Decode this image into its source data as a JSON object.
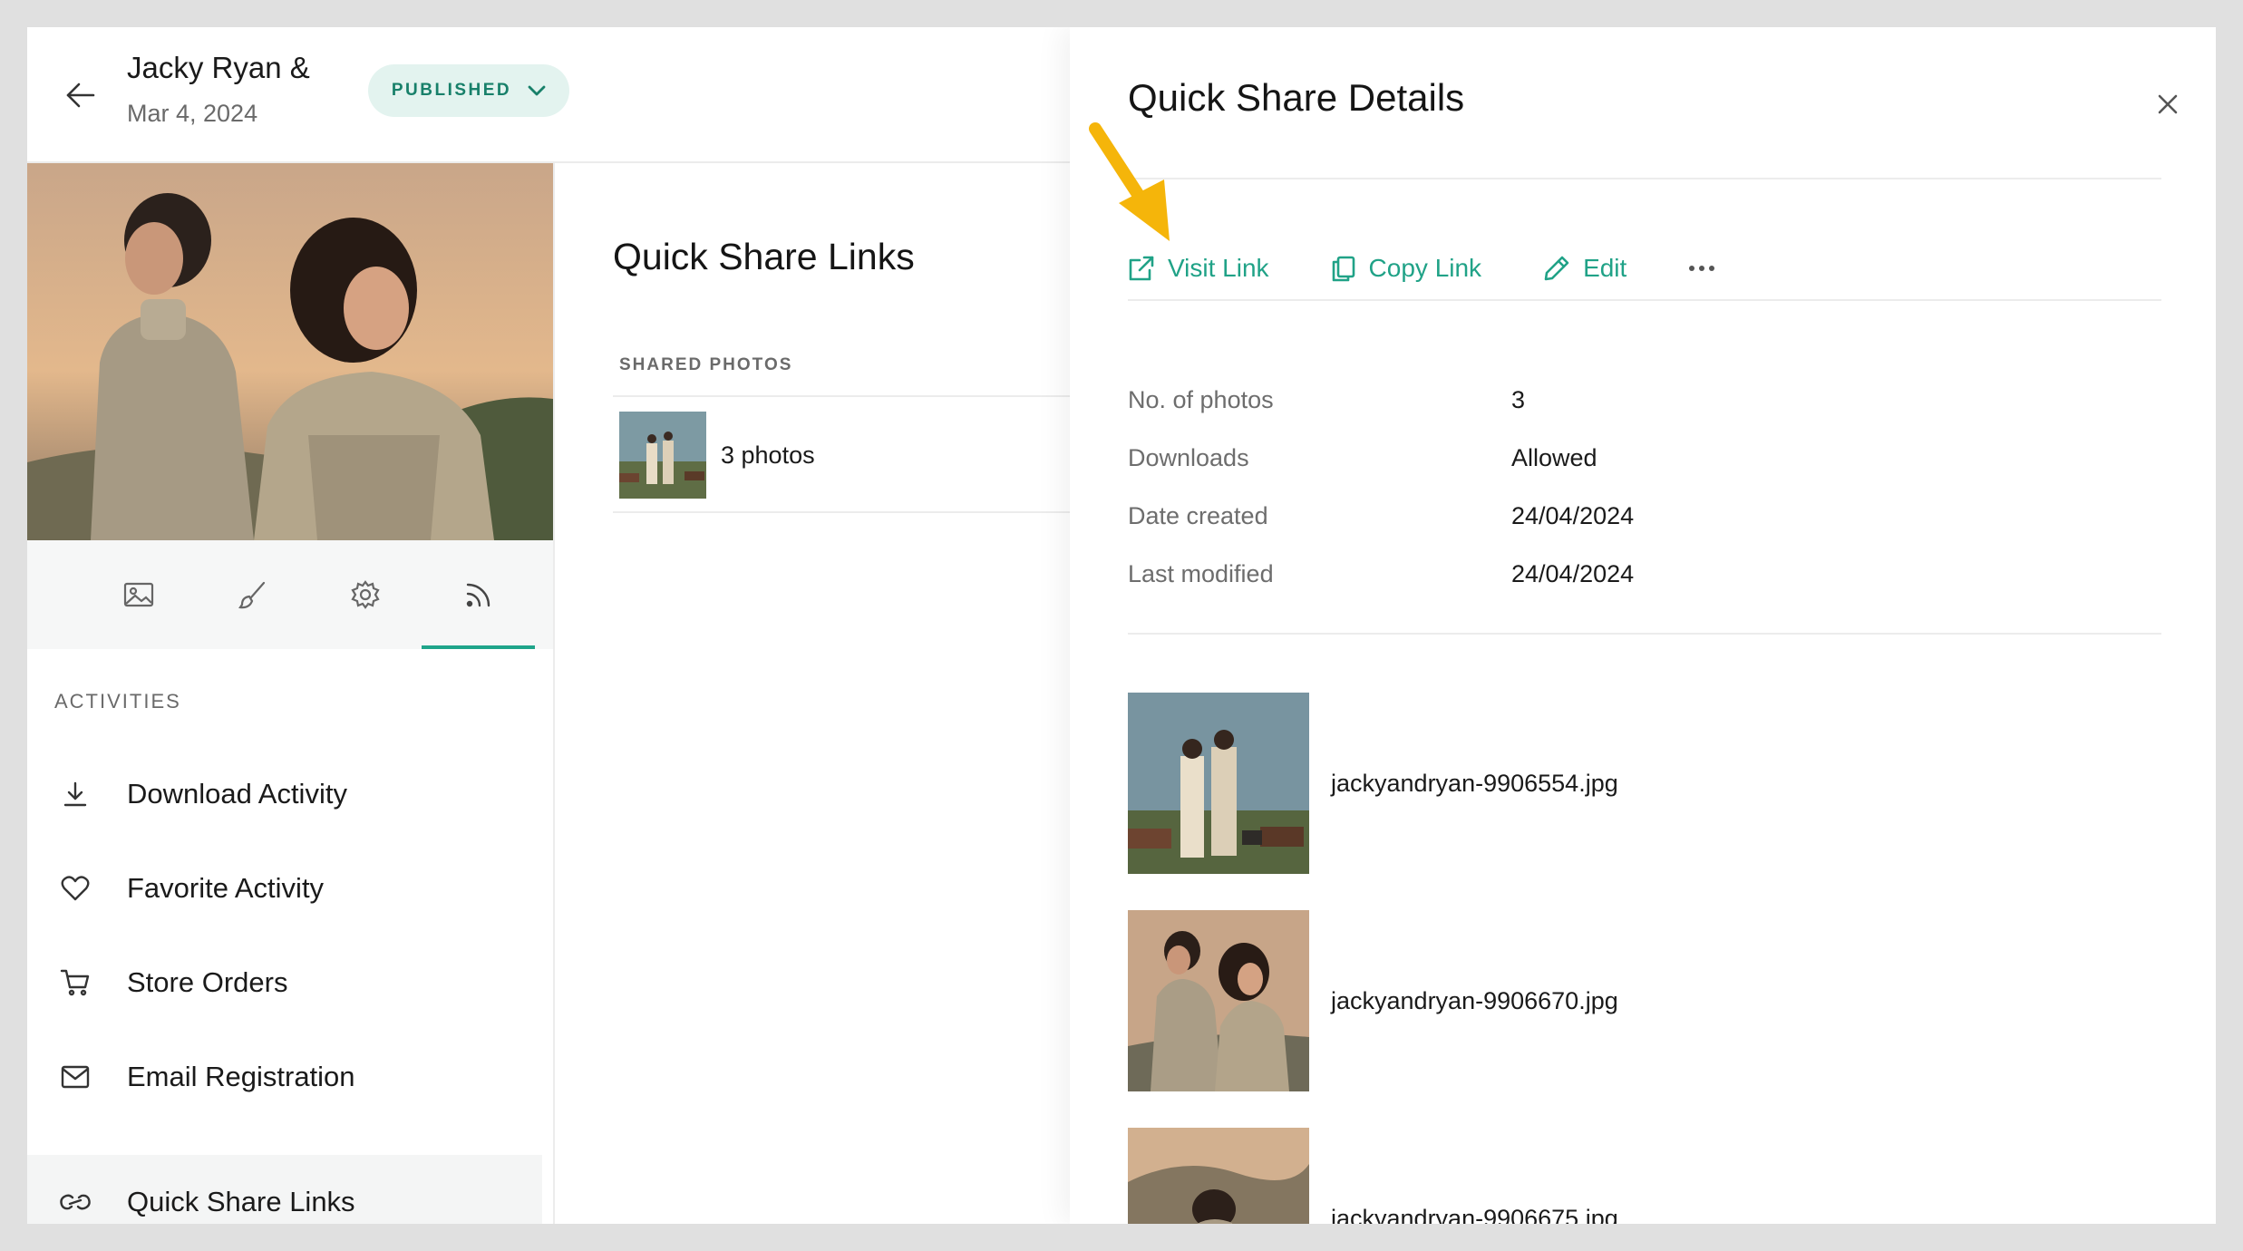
{
  "header": {
    "title": "Jacky Ryan &",
    "date": "Mar 4, 2024",
    "status": "PUBLISHED"
  },
  "icons": {
    "back": "arrow-left-icon",
    "status_chevron": "chevron-down-icon",
    "tabs": [
      "image-icon",
      "brush-icon",
      "gear-icon",
      "rss-icon"
    ]
  },
  "sidebar": {
    "heading": "ACTIVITIES",
    "items": [
      {
        "label": "Download Activity",
        "icon": "download-icon"
      },
      {
        "label": "Favorite Activity",
        "icon": "heart-icon"
      },
      {
        "label": "Store Orders",
        "icon": "cart-icon"
      },
      {
        "label": "Email Registration",
        "icon": "mail-icon"
      },
      {
        "label": "Quick Share Links",
        "icon": "link-icon",
        "selected": true
      }
    ]
  },
  "links_panel": {
    "title": "Quick Share Links",
    "column_header": "SHARED PHOTOS",
    "rows": [
      {
        "label": "3 photos"
      }
    ]
  },
  "drawer": {
    "title": "Quick Share Details",
    "actions": [
      {
        "label": "Visit Link",
        "icon": "external-link-icon"
      },
      {
        "label": "Copy Link",
        "icon": "copy-icon"
      },
      {
        "label": "Edit",
        "icon": "pencil-icon"
      }
    ],
    "details": [
      {
        "label": "No. of photos",
        "value": "3"
      },
      {
        "label": "Downloads",
        "value": "Allowed"
      },
      {
        "label": "Date created",
        "value": "24/04/2024"
      },
      {
        "label": "Last modified",
        "value": "24/04/2024"
      }
    ],
    "photos": [
      {
        "name": "jackyandryan-9906554.jpg"
      },
      {
        "name": "jackyandryan-9906670.jpg"
      },
      {
        "name": "jackyandryan-9906675.jpg"
      }
    ]
  },
  "colors": {
    "accent": "#20a287",
    "status_bg": "#e3f3ef",
    "status_text": "#18806a",
    "annotation_arrow": "#f5b50a"
  }
}
